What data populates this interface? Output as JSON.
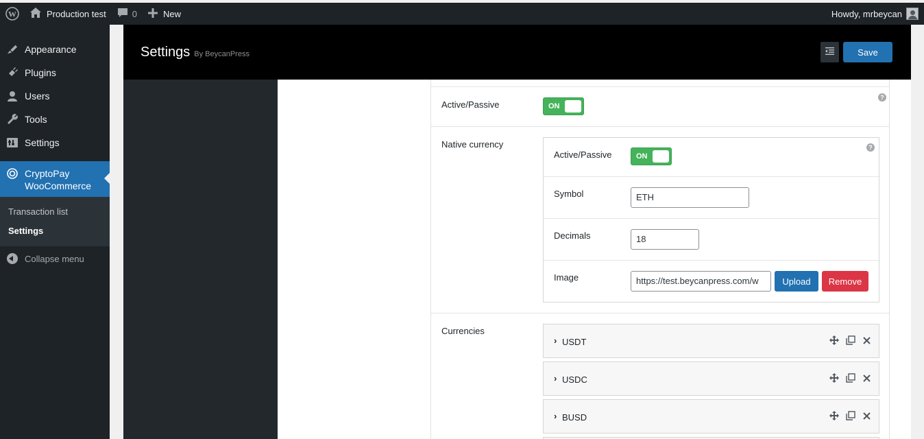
{
  "adminbar": {
    "site_name": "Production test",
    "comments_count": "0",
    "new_label": "New",
    "howdy": "Howdy, mrbeycan"
  },
  "sidebar": {
    "items": [
      {
        "label": "Appearance",
        "icon": "paintbrush-icon"
      },
      {
        "label": "Plugins",
        "icon": "plugin-icon"
      },
      {
        "label": "Users",
        "icon": "users-icon"
      },
      {
        "label": "Tools",
        "icon": "wrench-icon"
      },
      {
        "label": "Settings",
        "icon": "settings-icon"
      }
    ],
    "current": {
      "label_line1": "CryptoPay",
      "label_line2": "WooCommerce",
      "icon": "cryptopay-icon"
    },
    "submenu": [
      {
        "label": "Transaction list"
      },
      {
        "label": "Settings"
      }
    ],
    "collapse_label": "Collapse menu"
  },
  "header": {
    "title": "Settings",
    "by": "By BeycanPress",
    "save_label": "Save"
  },
  "fields": {
    "active_passive_label": "Active/Passive",
    "toggle_on": "ON",
    "native_currency_label": "Native currency",
    "native": {
      "active_passive_label": "Active/Passive",
      "toggle_on": "ON",
      "symbol_label": "Symbol",
      "symbol_value": "ETH",
      "decimals_label": "Decimals",
      "decimals_value": "18",
      "image_label": "Image",
      "image_value": "https://test.beycanpress.com/w",
      "upload_label": "Upload",
      "remove_label": "Remove"
    },
    "currencies_label": "Currencies",
    "currencies": [
      {
        "name": "USDT"
      },
      {
        "name": "USDC"
      },
      {
        "name": "BUSD"
      }
    ]
  },
  "colors": {
    "admin_bg": "#1d2327",
    "accent": "#2271b1",
    "toggle_green": "#45b35a",
    "remove_red": "#dc3545"
  }
}
